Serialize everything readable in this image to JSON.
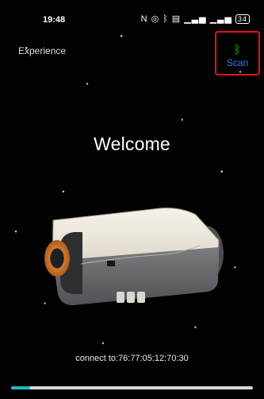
{
  "status_bar": {
    "time": "19:48",
    "icons": [
      "nfc-icon",
      "alarm-icon",
      "bluetooth-icon",
      "hd-icon",
      "signal-icon",
      "signal-icon-2"
    ],
    "battery": "34"
  },
  "header": {
    "experience_label": "Experience",
    "scan_label": "Scan",
    "scan_icon": "bluetooth-icon",
    "accent_color": "#2ad32a",
    "highlight_color": "#ee1111"
  },
  "main": {
    "welcome_text": "Welcome",
    "connect_text": "connect to:76:77:05:12:70:30"
  },
  "bottom": {
    "progress_fraction": 0.08
  }
}
